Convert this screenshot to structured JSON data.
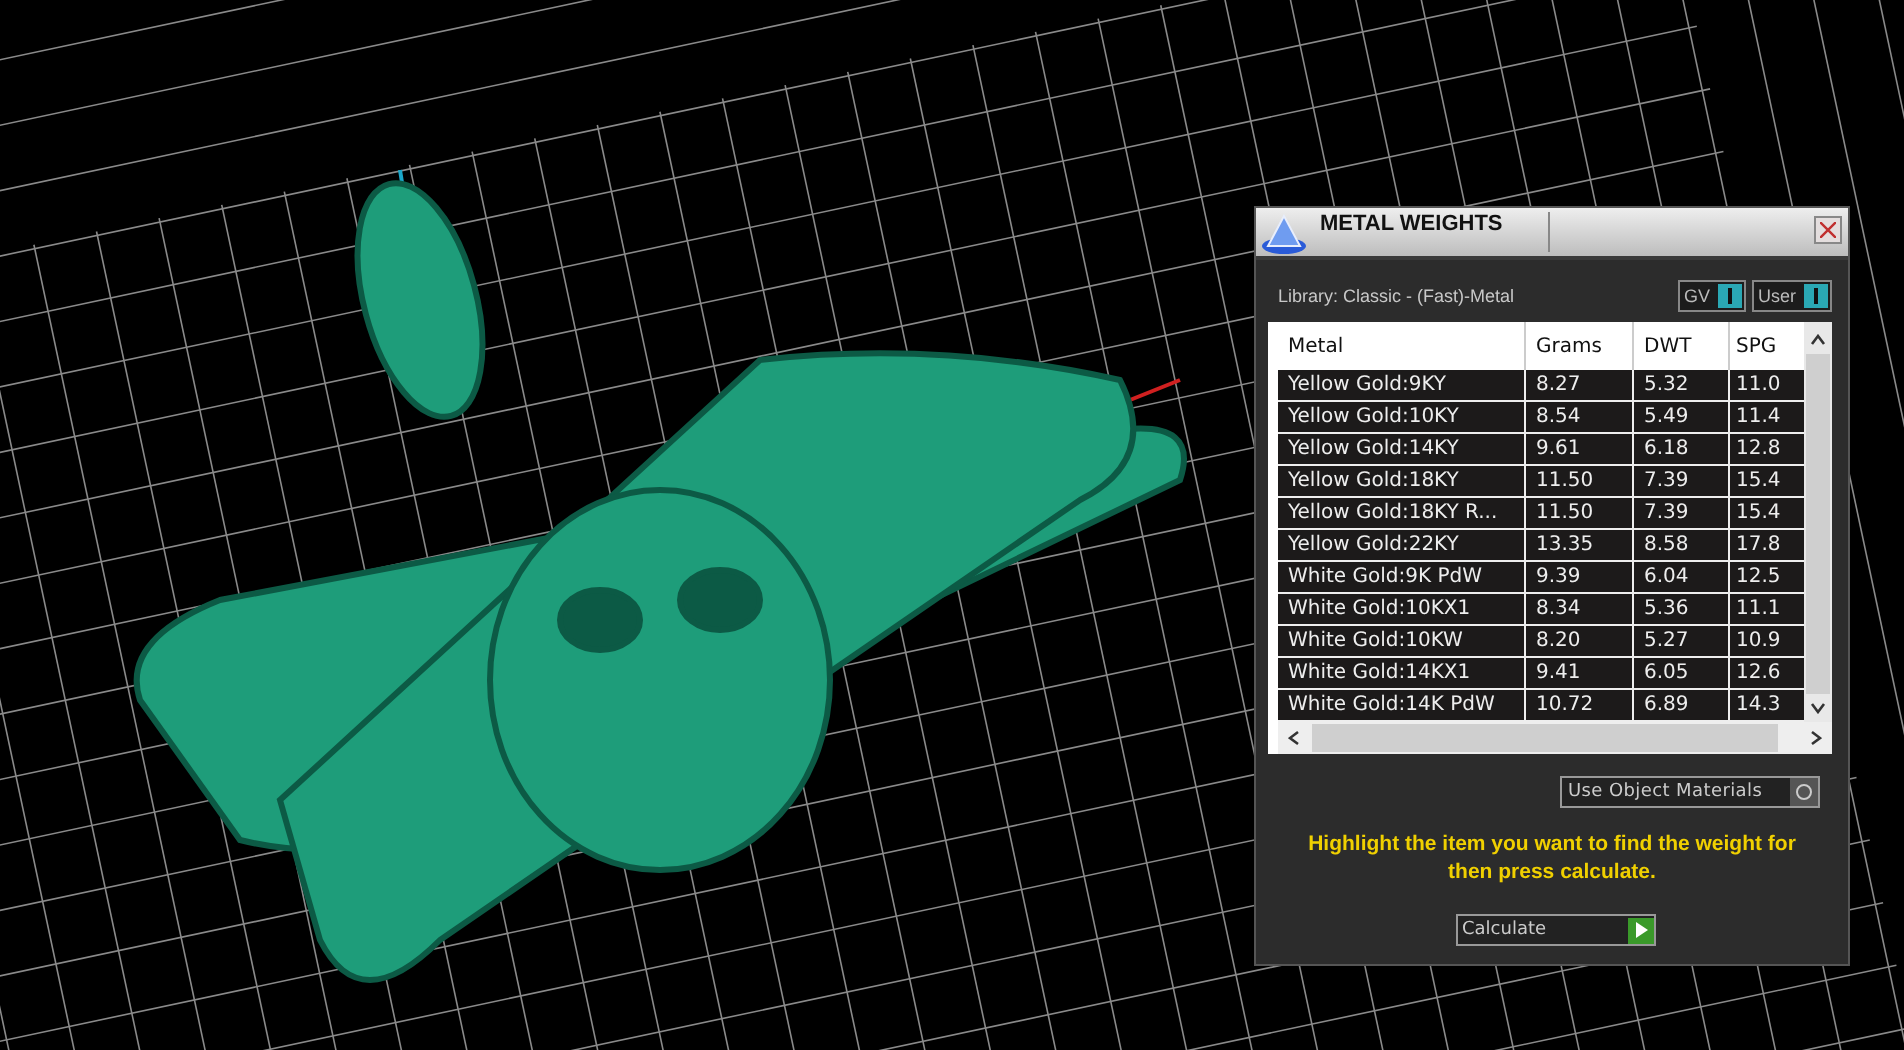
{
  "panel": {
    "title": "METAL WEIGHTS",
    "library": "Library: Classic - (Fast)-Metal",
    "toggles": [
      {
        "label": "GV",
        "on": true
      },
      {
        "label": "User",
        "on": true
      }
    ],
    "table": {
      "columns": [
        "Metal",
        "Grams",
        "DWT",
        "SPG"
      ],
      "rows": [
        [
          "Yellow Gold:9KY",
          "8.27",
          "5.32",
          "11.0"
        ],
        [
          "Yellow Gold:10KY",
          "8.54",
          "5.49",
          "11.4"
        ],
        [
          "Yellow Gold:14KY",
          "9.61",
          "6.18",
          "12.8"
        ],
        [
          "Yellow Gold:18KY",
          "11.50",
          "7.39",
          "15.4"
        ],
        [
          "Yellow Gold:18KY R...",
          "11.50",
          "7.39",
          "15.4"
        ],
        [
          "Yellow Gold:22KY",
          "13.35",
          "8.58",
          "17.8"
        ],
        [
          "White Gold:9K PdW",
          "9.39",
          "6.04",
          "12.5"
        ],
        [
          "White Gold:10KX1",
          "8.34",
          "5.36",
          "11.1"
        ],
        [
          "White Gold:10KW",
          "8.20",
          "5.27",
          "10.9"
        ],
        [
          "White Gold:14KX1",
          "9.41",
          "6.05",
          "12.6"
        ],
        [
          "White Gold:14K PdW",
          "10.72",
          "6.89",
          "14.3"
        ]
      ]
    },
    "use_object_materials": {
      "label": "Use Object Materials",
      "checked": false
    },
    "hint": "Highlight the item you want to find the weight for then press calculate.",
    "calculate": "Calculate"
  }
}
